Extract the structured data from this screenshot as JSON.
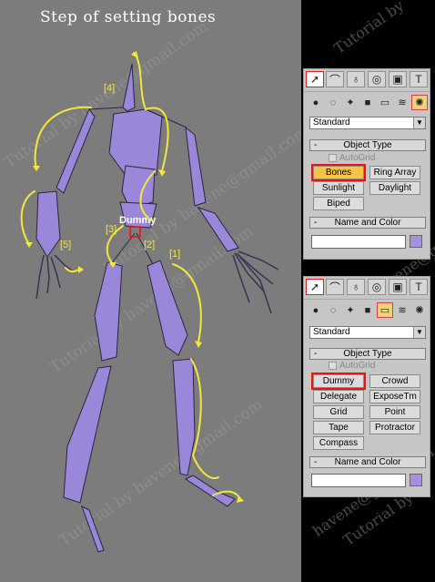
{
  "title": "Step of setting bones",
  "viewport": {
    "bg_color": "#7c7c7c",
    "bone_color": "#9b87da",
    "annotation_color": "#f3e83a",
    "dummy_label": "Dummy",
    "step_labels": [
      "[1]",
      "[2]",
      "[3]",
      "[4]",
      "[5]"
    ],
    "watermarks": [
      "Tutorial by havene@gmail.com",
      "Tutorial by havene@gmail.com",
      "Tutorial by havene@gmail.com",
      "Tutorial by havene@gmail.com"
    ]
  },
  "right_strip_watermarks": [
    "Tutorial by",
    "havene@gmail.com",
    "havene@gma",
    "Tutorial by"
  ],
  "panel1": {
    "tabs": [
      "create-tab",
      "modify-tab",
      "hierarchy-tab",
      "motion-tab",
      "display-tab",
      "utilities-tab"
    ],
    "subcategories": [
      "geometry",
      "shapes",
      "lights",
      "cameras",
      "helpers",
      "spacewarps",
      "systems"
    ],
    "active_subcategory": "systems",
    "dropdown_value": "Standard",
    "object_type_header": "Object Type",
    "autogrid_label": "AutoGrid",
    "buttons": [
      "Bones",
      "Ring Array",
      "Sunlight",
      "Daylight",
      "Biped"
    ],
    "selected_button": "Bones",
    "name_color_header": "Name and Color"
  },
  "panel2": {
    "tabs": [
      "create-tab",
      "modify-tab",
      "hierarchy-tab",
      "motion-tab",
      "display-tab",
      "utilities-tab"
    ],
    "subcategories": [
      "geometry",
      "shapes",
      "lights",
      "cameras",
      "helpers",
      "spacewarps",
      "systems"
    ],
    "active_subcategory": "helpers",
    "dropdown_value": "Standard",
    "object_type_header": "Object Type",
    "autogrid_label": "AutoGrid",
    "buttons": [
      "Dummy",
      "Crowd",
      "Delegate",
      "ExposeTm",
      "Grid",
      "Point",
      "Tape",
      "Protractor",
      "Compass"
    ],
    "selected_button": "Dummy",
    "name_color_header": "Name and Color"
  }
}
